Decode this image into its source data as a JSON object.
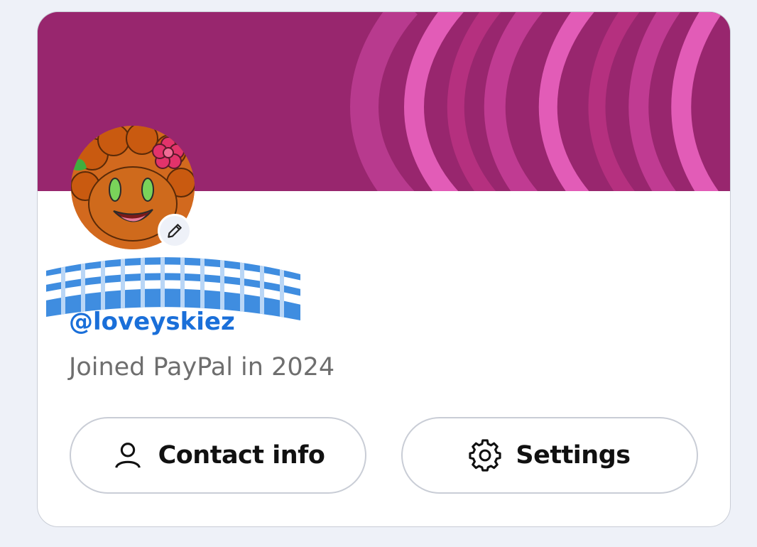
{
  "profile": {
    "username": "@loveyskiez",
    "joined_text": "Joined PayPal in 2024"
  },
  "actions": {
    "contact_label": "Contact info",
    "settings_label": "Settings"
  },
  "icons": {
    "edit": "pencil-icon",
    "contact": "person-icon",
    "settings": "gear-icon"
  },
  "colors": {
    "banner_base": "#98266e",
    "banner_stripe": "#e25cb7",
    "username": "#1a6fd9",
    "page_bg": "#eef1f8"
  }
}
